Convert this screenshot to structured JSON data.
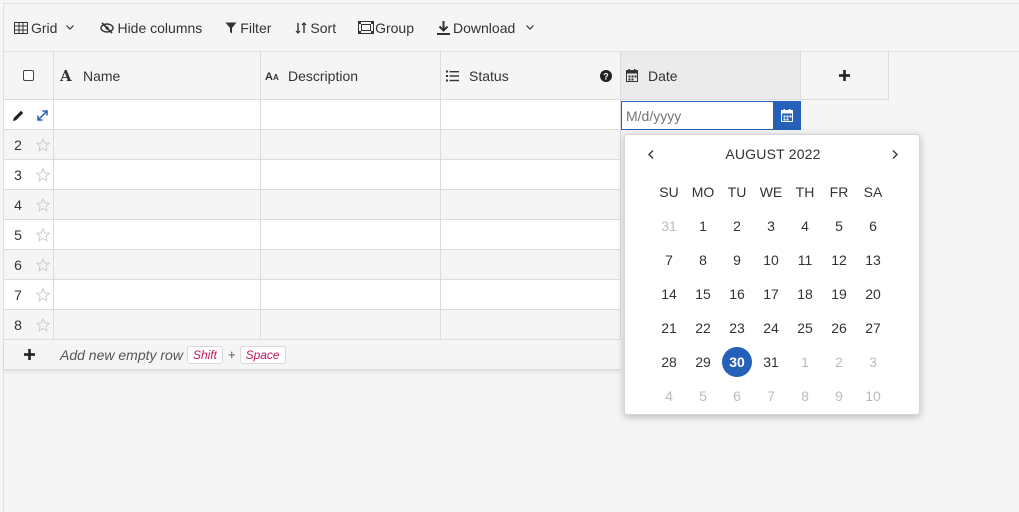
{
  "toolbar": {
    "grid_label": "Grid",
    "hide_columns_label": "Hide columns",
    "filter_label": "Filter",
    "sort_label": "Sort",
    "group_label": "Group",
    "download_label": "Download"
  },
  "columns": [
    {
      "label": "Name",
      "icon": "text-a-icon"
    },
    {
      "label": "Description",
      "icon": "text-aa-icon"
    },
    {
      "label": "Status",
      "icon": "list-icon"
    },
    {
      "label": "Date",
      "icon": "calendar-icon"
    }
  ],
  "rows": [
    "2",
    "3",
    "4",
    "5",
    "6",
    "7",
    "8"
  ],
  "add_row": {
    "text": "Add new empty row",
    "key1": "Shift",
    "plus": "+",
    "key2": "Space"
  },
  "date_input": {
    "placeholder": "M/d/yyyy"
  },
  "datepicker": {
    "month_label": "AUGUST 2022",
    "weekdays": [
      "SU",
      "MO",
      "TU",
      "WE",
      "TH",
      "FR",
      "SA"
    ],
    "weeks": [
      [
        "31",
        "1",
        "2",
        "3",
        "4",
        "5",
        "6"
      ],
      [
        "7",
        "8",
        "9",
        "10",
        "11",
        "12",
        "13"
      ],
      [
        "14",
        "15",
        "16",
        "17",
        "18",
        "19",
        "20"
      ],
      [
        "21",
        "22",
        "23",
        "24",
        "25",
        "26",
        "27"
      ],
      [
        "28",
        "29",
        "30",
        "31",
        "1",
        "2",
        "3"
      ],
      [
        "4",
        "5",
        "6",
        "7",
        "8",
        "9",
        "10"
      ]
    ],
    "selected": "30"
  },
  "colors": {
    "accent": "#2561b8",
    "kbd_text": "#c2185b"
  }
}
